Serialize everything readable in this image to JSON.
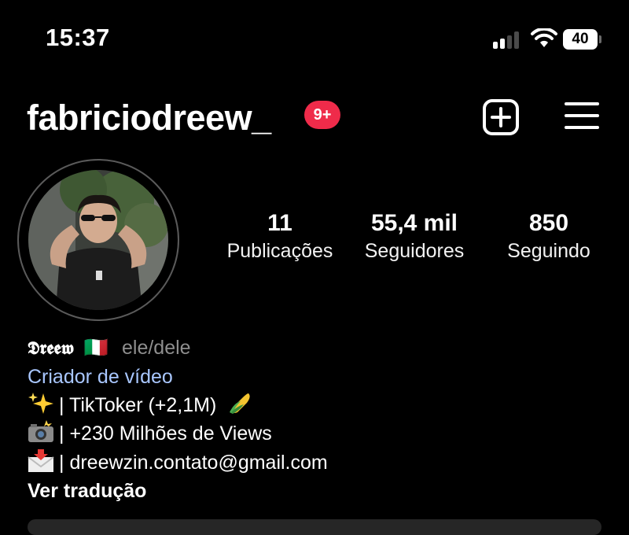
{
  "status_bar": {
    "time": "15:37",
    "battery": "40",
    "icons": [
      "signal-icon",
      "wifi-icon",
      "battery-icon"
    ]
  },
  "header": {
    "username": "fabriciodreew_",
    "notification_badge": "9+",
    "icons": [
      "plus-square-icon",
      "menu-icon"
    ]
  },
  "stats": [
    {
      "value": "11",
      "label": "Publicações"
    },
    {
      "value": "55,4 mil",
      "label": "Seguidores"
    },
    {
      "value": "850",
      "label": "Seguindo"
    }
  ],
  "bio": {
    "display_name": "𝕯𝖗𝖊𝖊𝖜",
    "flag": "🇮🇹",
    "pronouns": "ele/dele",
    "category": "Criador de vídeo",
    "lines": [
      {
        "emoji": "sparkles-icon",
        "text": "| TikToker (+2,1M)",
        "trailing_emoji": "corn-icon"
      },
      {
        "emoji": "camera-flash-icon",
        "text": "| +230 Milhões de Views"
      },
      {
        "emoji": "envelope-arrow-icon",
        "text": "| dreewzin.contato@gmail.com"
      }
    ],
    "translate": "Ver tradução"
  },
  "colors": {
    "background": "#000000",
    "badge": "#ef2b4a",
    "category_link": "#a9c7ff",
    "muted": "#8e8e8e"
  }
}
